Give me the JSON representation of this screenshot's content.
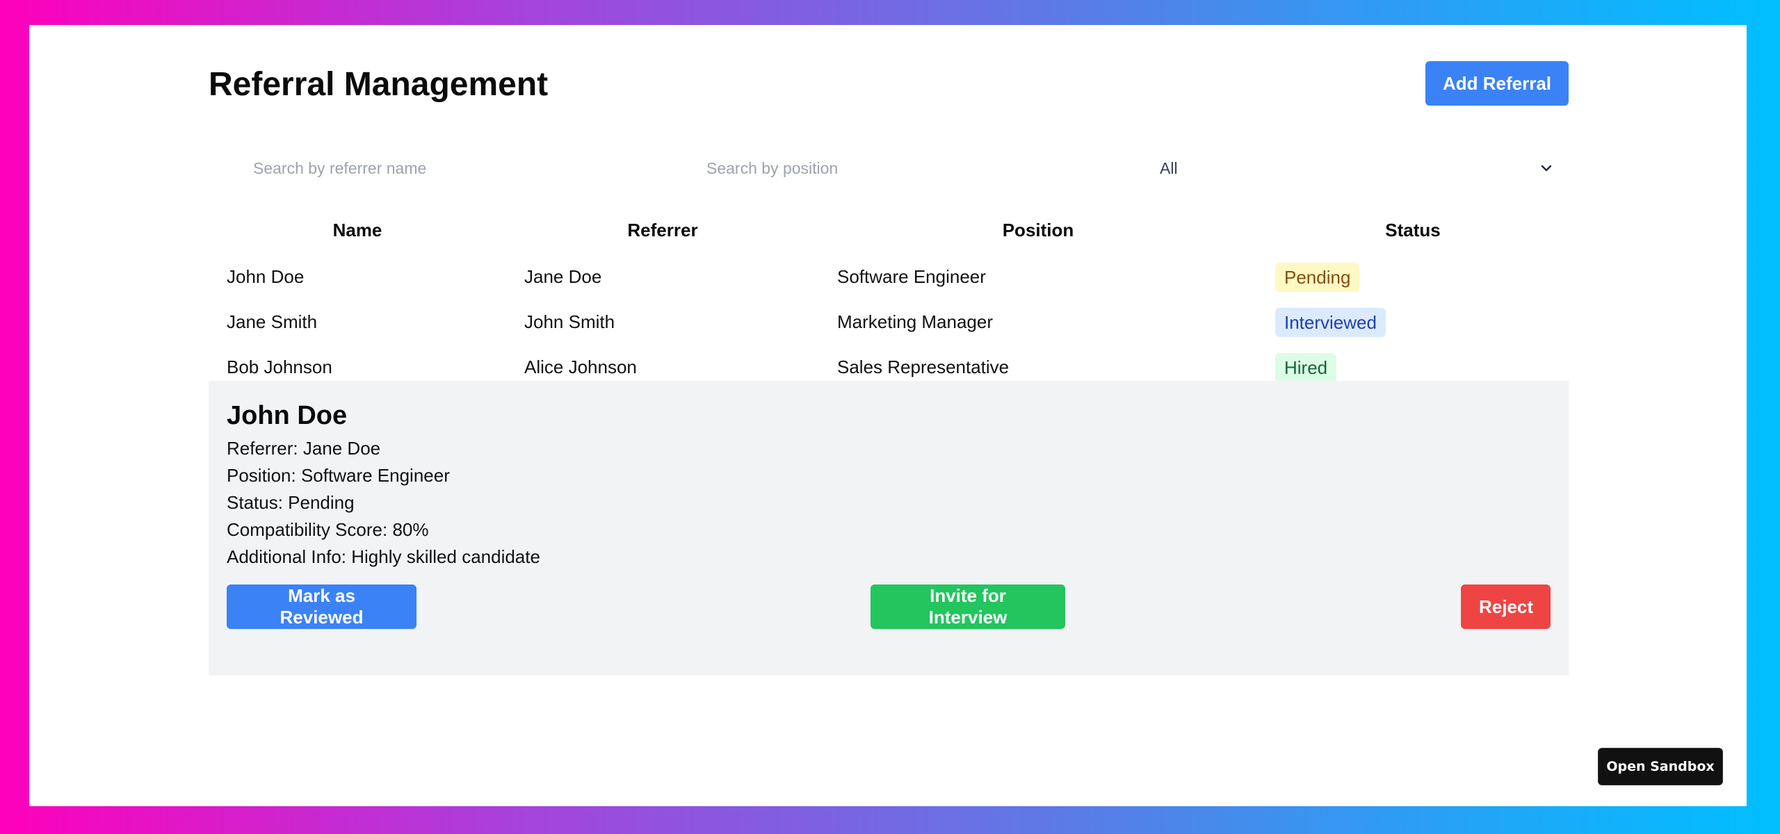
{
  "header": {
    "title": "Referral Management",
    "add_button_label": "Add Referral"
  },
  "filters": {
    "referrer_placeholder": "Search by referrer name",
    "position_placeholder": "Search by position",
    "status_selected": "All",
    "status_icon": "chevron-down-icon"
  },
  "table": {
    "columns": [
      "Name",
      "Referrer",
      "Position",
      "Status"
    ],
    "rows": [
      {
        "name": "John Doe",
        "referrer": "Jane Doe",
        "position": "Software Engineer",
        "status": "Pending"
      },
      {
        "name": "Jane Smith",
        "referrer": "John Smith",
        "position": "Marketing Manager",
        "status": "Interviewed"
      },
      {
        "name": "Bob Johnson",
        "referrer": "Alice Johnson",
        "position": "Sales Representative",
        "status": "Hired"
      }
    ]
  },
  "status_colors": {
    "Pending": {
      "bg": "#fef9c3",
      "fg": "#854d0e"
    },
    "Interviewed": {
      "bg": "#dbeafe",
      "fg": "#1e40af"
    },
    "Hired": {
      "bg": "#dcfce7",
      "fg": "#166534"
    }
  },
  "detail": {
    "name": "John Doe",
    "referrer_label": "Referrer:",
    "referrer": "Jane Doe",
    "position_label": "Position:",
    "position": "Software Engineer",
    "status_label": "Status:",
    "status": "Pending",
    "score_label": "Compatibility Score:",
    "score": "80%",
    "info_label": "Additional Info:",
    "info": "Highly skilled candidate",
    "actions": {
      "reviewed": "Mark as Reviewed",
      "invite": "Invite for Interview",
      "reject": "Reject"
    }
  },
  "colors": {
    "primary": "#3b82f6",
    "success": "#22c55e",
    "danger": "#ef4444",
    "panel_bg": "#f2f3f5"
  },
  "sandbox": {
    "label": "Open Sandbox"
  }
}
